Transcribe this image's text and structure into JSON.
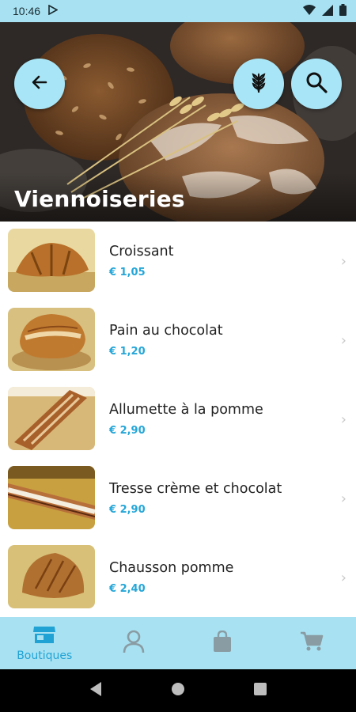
{
  "status_bar": {
    "time": "10:46",
    "icons": [
      "play-store-icon",
      "wifi-icon",
      "signal-icon",
      "battery-icon"
    ]
  },
  "header": {
    "title": "Viennoiseries",
    "buttons": [
      "back-icon",
      "wheat-icon",
      "search-icon"
    ]
  },
  "products": [
    {
      "name": "Croissant",
      "price": "€ 1,05"
    },
    {
      "name": "Pain au chocolat",
      "price": "€ 1,20"
    },
    {
      "name": "Allumette à la pomme",
      "price": "€ 2,90"
    },
    {
      "name": "Tresse crème et chocolat",
      "price": "€ 2,90"
    },
    {
      "name": "Chausson pomme",
      "price": "€ 2,40"
    }
  ],
  "bottom_nav": {
    "items": [
      {
        "label": "Boutiques",
        "icon": "store-icon",
        "active": true
      },
      {
        "label": "",
        "icon": "person-icon",
        "active": false
      },
      {
        "label": "",
        "icon": "bag-icon",
        "active": false
      },
      {
        "label": "",
        "icon": "cart-icon",
        "active": false
      }
    ]
  },
  "colors": {
    "accent": "#25a6d8",
    "bar": "#a8e2f2",
    "button": "#a8e6f7",
    "inactive_icon": "#8a9ca3"
  }
}
